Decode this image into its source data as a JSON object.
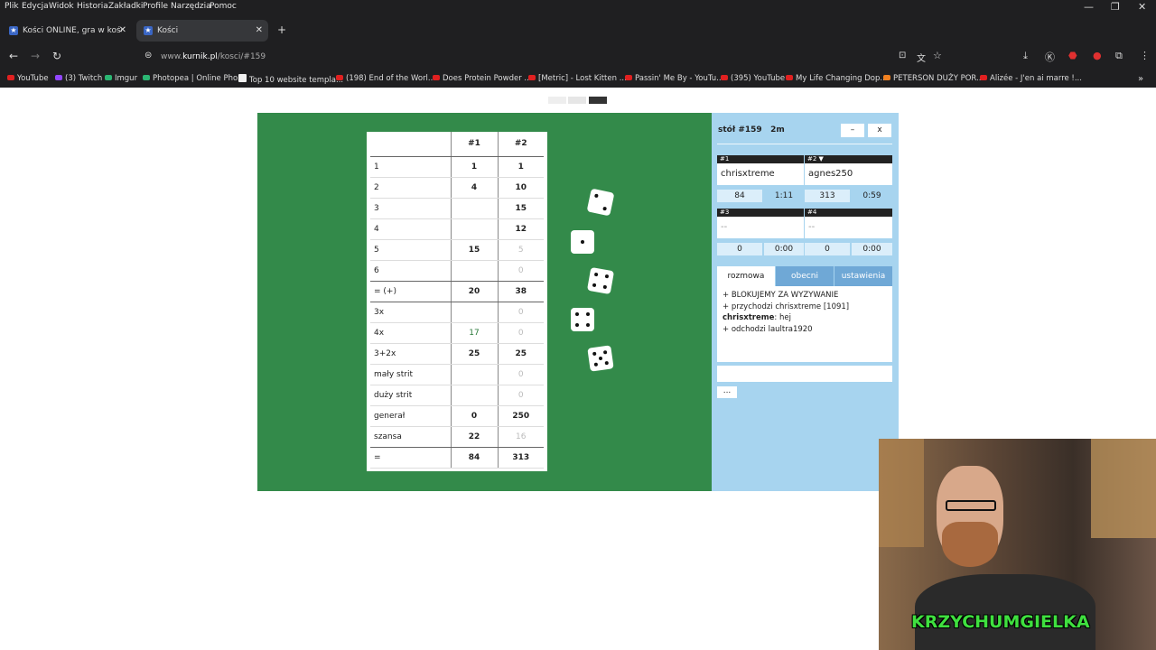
{
  "menu": [
    "Plik",
    "Edycja",
    "Widok",
    "Historia",
    "Zakładki",
    "Profile",
    "Narzędzia",
    "Pomoc"
  ],
  "tabs": [
    {
      "label": "Kości ONLINE, gra w kości, zagr"
    },
    {
      "label": "Kości"
    }
  ],
  "address": {
    "prefix": "www.",
    "domain": "kurnik.pl",
    "path": "/kosci/#159"
  },
  "bookmarks": [
    "YouTube",
    "(3) Twitch",
    "Imgur",
    "Photopea | Online Pho...",
    "Top 10 website templa...",
    "(198) End of the Worl...",
    "Does Protein Powder ...",
    "[Metric] - Lost Kitten ...",
    "Passin' Me By - YouTu...",
    "(395) YouTube",
    "My Life Changing Dop...",
    "PETERSON DUŻY POR...",
    "Alizée - J'en ai marre !..."
  ],
  "scoreboard": {
    "headers": [
      "",
      "#1",
      "#2"
    ],
    "rows": [
      {
        "label": "1",
        "p1": "1",
        "p2": "1"
      },
      {
        "label": "2",
        "p1": "4",
        "p2": "10"
      },
      {
        "label": "3",
        "p1": "",
        "p2": "15"
      },
      {
        "label": "4",
        "p1": "",
        "p2": "12"
      },
      {
        "label": "5",
        "p1": "15",
        "p2": "5"
      },
      {
        "label": "6",
        "p1": "",
        "p2": "0"
      },
      {
        "label": "= (+)",
        "p1": "20",
        "p2": "38"
      },
      {
        "label": "3x",
        "p1": "",
        "p2": "0"
      },
      {
        "label": "4x",
        "p1": "17",
        "p2": "0"
      },
      {
        "label": "3+2x",
        "p1": "25",
        "p2": "25"
      },
      {
        "label": "mały strit",
        "p1": "",
        "p2": "0"
      },
      {
        "label": "duży strit",
        "p1": "",
        "p2": "0"
      },
      {
        "label": "generał",
        "p1": "0",
        "p2": "250"
      },
      {
        "label": "szansa",
        "p1": "22",
        "p2": "16"
      },
      {
        "label": "=",
        "p1": "84",
        "p2": "313"
      }
    ]
  },
  "dice": [
    2,
    1,
    4,
    4,
    5
  ],
  "panel": {
    "title": "stół #159",
    "time": "2m",
    "min_btn": "–",
    "close_btn": "x",
    "players": [
      {
        "slot": "#1",
        "name": "chrisxtreme",
        "score": "84",
        "time": "1:11"
      },
      {
        "slot": "#2 ▼",
        "name": "agnes250",
        "score": "313",
        "time": "0:59"
      },
      {
        "slot": "#3",
        "name": "--",
        "score": "0",
        "time": "0:00"
      },
      {
        "slot": "#4",
        "name": "--",
        "score": "0",
        "time": "0:00"
      }
    ],
    "tabs": [
      "rozmowa",
      "obecni",
      "ustawienia"
    ],
    "chat": [
      {
        "user": "",
        "text": "+ BLOKUJEMY ZA WYZYWANIE"
      },
      {
        "user": "",
        "text": "+ przychodzi chrisxtreme [1091]"
      },
      {
        "user": "chrisxtreme",
        "text": ": hej"
      },
      {
        "user": "",
        "text": "+ odchodzi laultra1920"
      }
    ],
    "more": "..."
  },
  "webcam": {
    "overlay": "KRZYCHUMGIELKA"
  }
}
